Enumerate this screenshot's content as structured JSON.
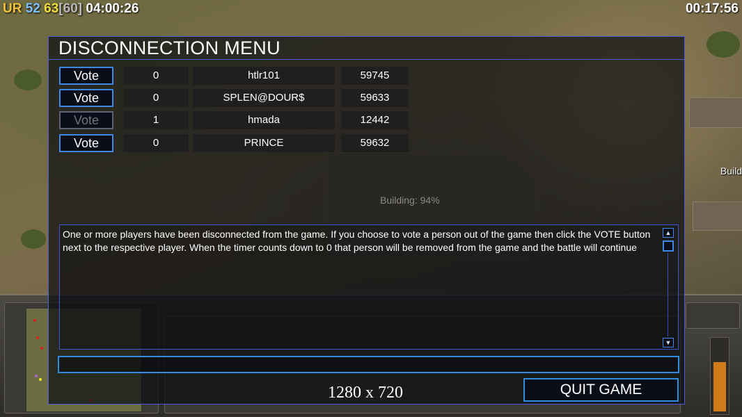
{
  "hud": {
    "ur_label": "UR",
    "fps": "52",
    "ping": "63",
    "fps_cap": "[60]",
    "elapsed": "04:00:26",
    "game_clock": "00:17:56",
    "side_label": "Build"
  },
  "world": {
    "building_status": "Building: 94%",
    "power_level": 0.7
  },
  "dialog": {
    "title": "DISCONNECTION MENU",
    "players": [
      {
        "vote_label": "Vote",
        "votes": "0",
        "name": "htlr101",
        "timer": "59745",
        "vote_enabled": true
      },
      {
        "vote_label": "Vote",
        "votes": "0",
        "name": "SPLEN@DOUR$",
        "timer": "59633",
        "vote_enabled": true
      },
      {
        "vote_label": "Vote",
        "votes": "1",
        "name": "hmada",
        "timer": "12442",
        "vote_enabled": false
      },
      {
        "vote_label": "Vote",
        "votes": "0",
        "name": "PRINCE",
        "timer": "59632",
        "vote_enabled": true
      }
    ],
    "message": "One or more players have been disconnected from the game. If you choose to vote a person out of the game then click the VOTE button next to the respective player. When the timer counts down to 0 that person will be removed from the game and the battle will continue",
    "chat_value": "",
    "resolution": "1280 x 720",
    "quit_label": "QUIT GAME"
  },
  "colors": {
    "dialog_border": "#4a5ad8",
    "button_border": "#3b88e8",
    "disabled_text": "#70747e",
    "accent_orange": "#d07a1a"
  }
}
